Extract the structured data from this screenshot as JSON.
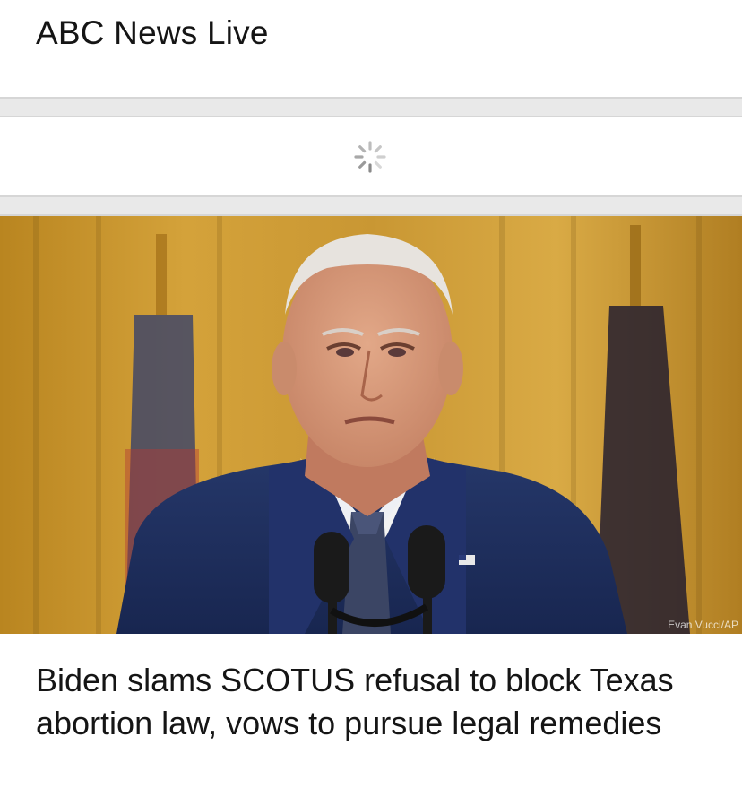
{
  "header": {
    "title": "ABC News Live"
  },
  "loader": {
    "icon": "loading-spinner-icon"
  },
  "article": {
    "image_credit": "Evan Vucci/AP",
    "headline": "Biden slams SCOTUS refusal to block Texas abortion law, vows to pursue legal remedies"
  },
  "colors": {
    "separator": "#e9e9e9",
    "text": "#151515",
    "curtain": "#c8962e",
    "suit": "#1e2e5c"
  }
}
